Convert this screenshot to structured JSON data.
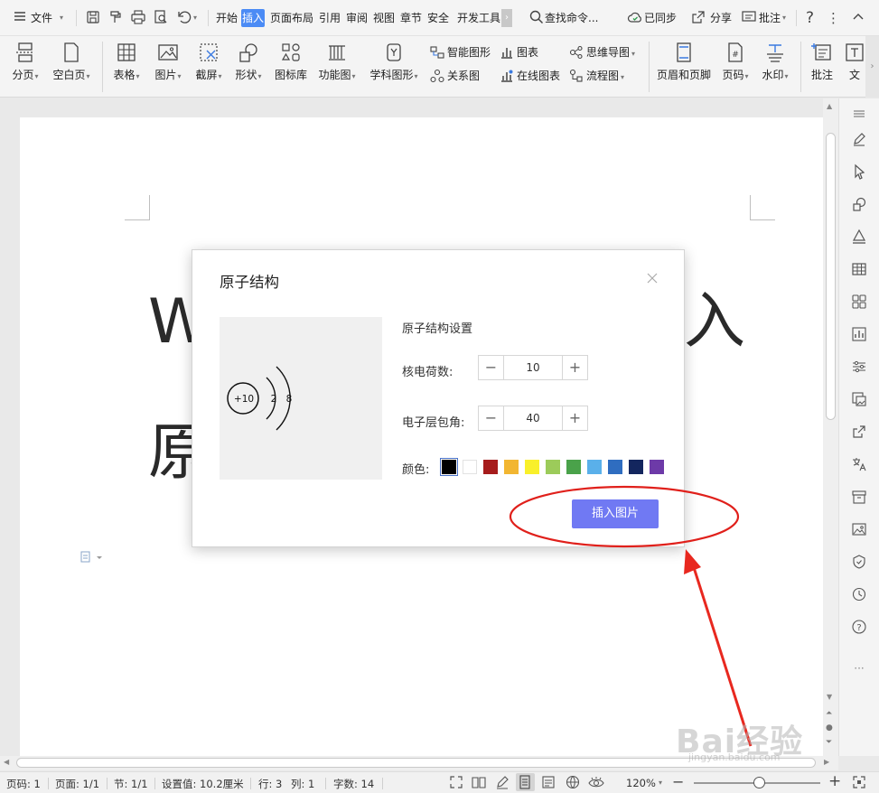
{
  "menubar": {
    "file": "文件",
    "tabs": [
      "开始",
      "插入",
      "页面布局",
      "引用",
      "审阅",
      "视图",
      "章节",
      "安全",
      "开发工具"
    ],
    "active_tab": "插入",
    "search": "查找命令...",
    "sync": "已同步",
    "share": "分享",
    "comment": "批注"
  },
  "ribbon": {
    "page_break": "分页",
    "blank_page": "空白页",
    "table": "表格",
    "picture": "图片",
    "screenshot": "截屏",
    "shape": "形状",
    "icon_lib": "图标库",
    "func_chart": "功能图",
    "subject_chart": "学科图形",
    "smart_art": "智能图形",
    "chart": "图表",
    "mind_map": "思维导图",
    "relation": "关系图",
    "online_chart": "在线图表",
    "flow_chart": "流程图",
    "header_footer": "页眉和页脚",
    "page_number": "页码",
    "watermark": "水印",
    "comment": "批注",
    "text": "文"
  },
  "document": {
    "line1": "W",
    "line1_end": "入",
    "line2": "原"
  },
  "dialog": {
    "title": "原子结构",
    "settings_title": "原子结构设置",
    "charge_label": "核电荷数:",
    "charge_value": "10",
    "angle_label": "电子层包角:",
    "angle_value": "40",
    "color_label": "颜色:",
    "colors": [
      "#000000",
      "#ffffff",
      "#a61c1c",
      "#f2b631",
      "#f9f02a",
      "#9ccb5a",
      "#4aa24a",
      "#5ab0ea",
      "#2f6dc0",
      "#13265e",
      "#6d3aa8"
    ],
    "insert_button": "插入图片",
    "preview": {
      "nucleus": "+10",
      "shells": [
        "2",
        "8"
      ]
    }
  },
  "statusbar": {
    "page_code": "页码: 1",
    "page": "页面: 1/1",
    "section": "节: 1/1",
    "setting": "设置值: 10.2厘米",
    "row": "行: 3",
    "col": "列: 1",
    "words": "字数: 14",
    "zoom": "120%"
  },
  "annotation": {
    "circle_color": "#e0201b",
    "arrow_color": "#e8281f"
  },
  "watermark": {
    "text": "Bai经验",
    "sub": "jingyan.baidu.com"
  }
}
